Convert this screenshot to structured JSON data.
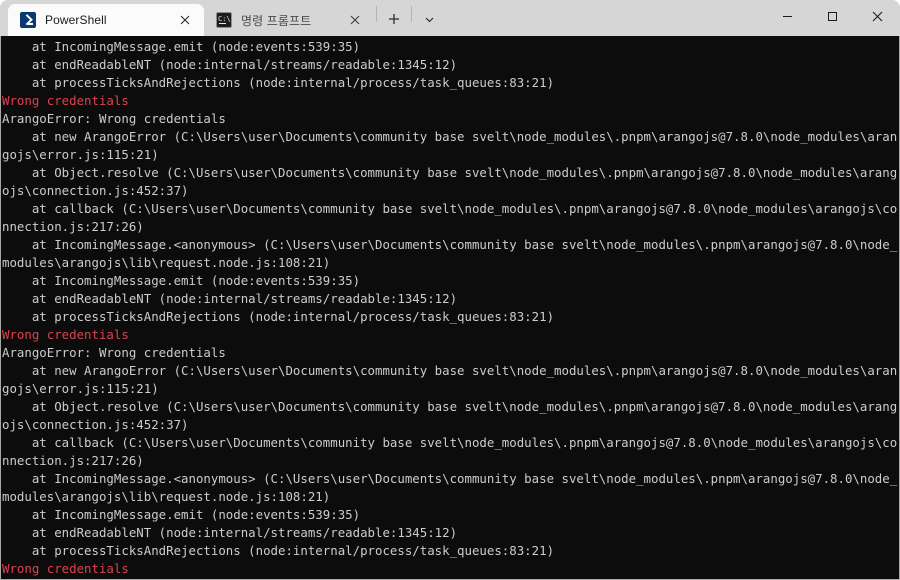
{
  "window": {
    "controls": {
      "minimize_label": "Minimize",
      "maximize_label": "Maximize",
      "close_label": "Close"
    }
  },
  "tabbar": {
    "tabs": [
      {
        "title": "PowerShell",
        "icon": "powershell-icon",
        "active": true,
        "close_label": "Close tab"
      },
      {
        "title": "명령 프롬프트",
        "icon": "command-prompt-icon",
        "active": false,
        "close_label": "Close tab"
      }
    ],
    "new_tab_label": "+",
    "dropdown_label": "v"
  },
  "terminal": {
    "background": "#0c0c0c",
    "foreground": "#cccccc",
    "error_color": "#d9434f",
    "lines": [
      {
        "text": "    at IncomingMessage.emit (node:events:539:35)",
        "error": false
      },
      {
        "text": "    at endReadableNT (node:internal/streams/readable:1345:12)",
        "error": false
      },
      {
        "text": "    at processTicksAndRejections (node:internal/process/task_queues:83:21)",
        "error": false
      },
      {
        "text": "Wrong credentials",
        "error": true
      },
      {
        "text": "ArangoError: Wrong credentials",
        "error": false
      },
      {
        "text": "    at new ArangoError (C:\\Users\\user\\Documents\\community base svelt\\node_modules\\.pnpm\\arangojs@7.8.0\\node_modules\\aran",
        "error": false
      },
      {
        "text": "gojs\\error.js:115:21)",
        "error": false
      },
      {
        "text": "    at Object.resolve (C:\\Users\\user\\Documents\\community base svelt\\node_modules\\.pnpm\\arangojs@7.8.0\\node_modules\\arang",
        "error": false
      },
      {
        "text": "ojs\\connection.js:452:37)",
        "error": false
      },
      {
        "text": "    at callback (C:\\Users\\user\\Documents\\community base svelt\\node_modules\\.pnpm\\arangojs@7.8.0\\node_modules\\arangojs\\co",
        "error": false
      },
      {
        "text": "nnection.js:217:26)",
        "error": false
      },
      {
        "text": "    at IncomingMessage.<anonymous> (C:\\Users\\user\\Documents\\community base svelt\\node_modules\\.pnpm\\arangojs@7.8.0\\node_",
        "error": false
      },
      {
        "text": "modules\\arangojs\\lib\\request.node.js:108:21)",
        "error": false
      },
      {
        "text": "    at IncomingMessage.emit (node:events:539:35)",
        "error": false
      },
      {
        "text": "    at endReadableNT (node:internal/streams/readable:1345:12)",
        "error": false
      },
      {
        "text": "    at processTicksAndRejections (node:internal/process/task_queues:83:21)",
        "error": false
      },
      {
        "text": "Wrong credentials",
        "error": true
      },
      {
        "text": "ArangoError: Wrong credentials",
        "error": false
      },
      {
        "text": "    at new ArangoError (C:\\Users\\user\\Documents\\community base svelt\\node_modules\\.pnpm\\arangojs@7.8.0\\node_modules\\aran",
        "error": false
      },
      {
        "text": "gojs\\error.js:115:21)",
        "error": false
      },
      {
        "text": "    at Object.resolve (C:\\Users\\user\\Documents\\community base svelt\\node_modules\\.pnpm\\arangojs@7.8.0\\node_modules\\arang",
        "error": false
      },
      {
        "text": "ojs\\connection.js:452:37)",
        "error": false
      },
      {
        "text": "    at callback (C:\\Users\\user\\Documents\\community base svelt\\node_modules\\.pnpm\\arangojs@7.8.0\\node_modules\\arangojs\\co",
        "error": false
      },
      {
        "text": "nnection.js:217:26)",
        "error": false
      },
      {
        "text": "    at IncomingMessage.<anonymous> (C:\\Users\\user\\Documents\\community base svelt\\node_modules\\.pnpm\\arangojs@7.8.0\\node_",
        "error": false
      },
      {
        "text": "modules\\arangojs\\lib\\request.node.js:108:21)",
        "error": false
      },
      {
        "text": "    at IncomingMessage.emit (node:events:539:35)",
        "error": false
      },
      {
        "text": "    at endReadableNT (node:internal/streams/readable:1345:12)",
        "error": false
      },
      {
        "text": "    at processTicksAndRejections (node:internal/process/task_queues:83:21)",
        "error": false
      },
      {
        "text": "Wrong credentials",
        "error": true
      }
    ]
  }
}
